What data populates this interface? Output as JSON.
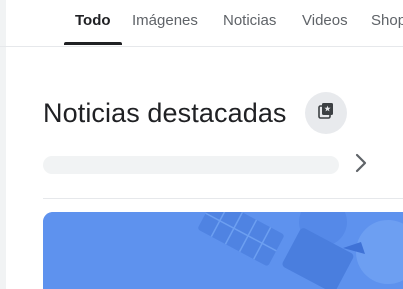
{
  "tabs": [
    {
      "label": "Todo",
      "active": true
    },
    {
      "label": "Imágenes",
      "active": false
    },
    {
      "label": "Noticias",
      "active": false
    },
    {
      "label": "Videos",
      "active": false
    },
    {
      "label": "Shop",
      "active": false
    }
  ],
  "section": {
    "title": "Noticias destacadas",
    "icon": "news-stack-icon",
    "next_icon": "chevron-right-icon"
  },
  "colors": {
    "active_tab": "#202124",
    "inactive_tab": "#5f6368",
    "icon_button_bg": "#e8eaed",
    "card_blue": "#5e92ee"
  }
}
